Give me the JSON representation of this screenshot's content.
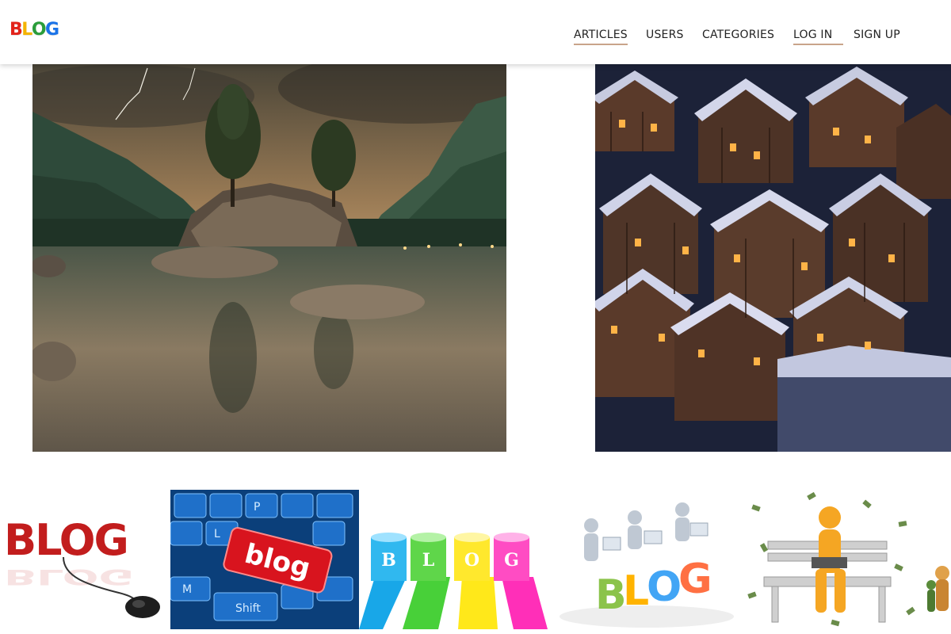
{
  "logo": {
    "letters": [
      "B",
      "L",
      "O",
      "G"
    ],
    "colors": [
      "#e2231a",
      "#f4b400",
      "#2a9d3a",
      "#1a73e8"
    ]
  },
  "nav": {
    "items": [
      {
        "label": "ARTICLES",
        "underlined": true
      },
      {
        "label": "USERS",
        "underlined": false
      },
      {
        "label": "CATEGORIES",
        "underlined": false
      },
      {
        "label": "LOG IN",
        "underlined": true
      },
      {
        "label": "SIGN UP",
        "underlined": false
      }
    ],
    "underline_color": "#c9a48a"
  },
  "hero": [
    {
      "subject": "mountain-lake-landscape"
    },
    {
      "subject": "snowy-village-night"
    }
  ],
  "thumbnails": [
    {
      "subject": "blog-3d-letters-mouse",
      "text": "BLOG"
    },
    {
      "subject": "blog-keyboard-key",
      "text": "blog",
      "key_labels": [
        "P",
        "L",
        "M",
        "Shift"
      ]
    },
    {
      "subject": "blog-paint-cans",
      "letters": [
        "B",
        "L",
        "O",
        "G"
      ]
    },
    {
      "subject": "blog-people-laptops",
      "letters": [
        "B",
        "L",
        "O",
        "G"
      ]
    },
    {
      "subject": "figure-bench-money"
    },
    {
      "subject": "partial-figure"
    }
  ]
}
